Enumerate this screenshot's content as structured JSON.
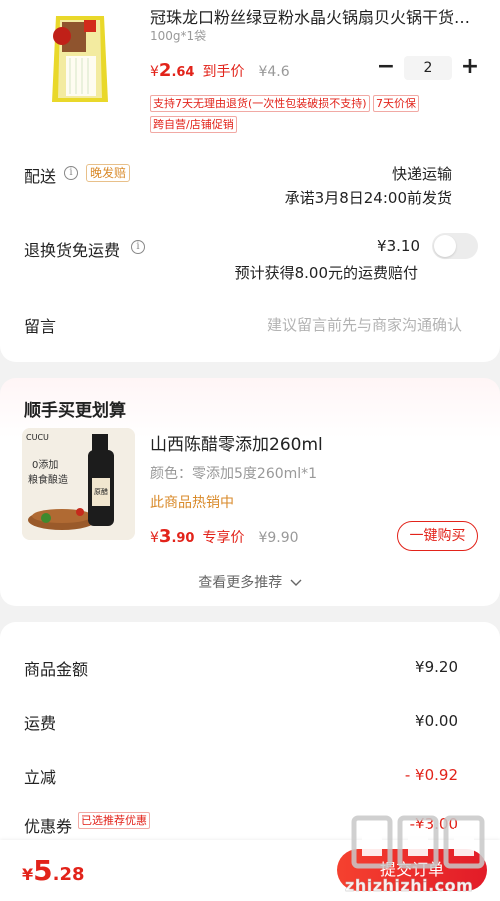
{
  "product": {
    "title": "冠珠龙口粉丝绿豆粉水晶火锅扇贝火锅干货粉丝",
    "spec": "100g*1袋",
    "currency": "¥",
    "price_int": "2",
    "price_dec": ".64",
    "price_tag": "到手价",
    "orig_price": "¥4.6",
    "quantity": "2",
    "minus": "−",
    "plus": "+",
    "tags": [
      "支持7天无理由退货(一次性包装破损不支持)",
      "7天价保",
      "跨自营/店铺促销"
    ]
  },
  "delivery": {
    "label": "配送",
    "info": "i",
    "late_badge": "晚发赔",
    "method": "快递运输",
    "promise": "承诺3月8日24:00前发货"
  },
  "return_shipping": {
    "label": "退换货免运费",
    "info": "i",
    "price": "¥3.10",
    "note": "预计获得8.00元的运费赔付"
  },
  "message": {
    "label": "留言",
    "placeholder": "建议留言前先与商家沟通确认"
  },
  "recommend": {
    "section_title": "顺手买更划算",
    "name": "山西陈醋零添加260ml",
    "spec": "颜色：零添加5度260ml*1",
    "hot": "此商品热销中",
    "currency": "¥",
    "price_int": "3",
    "price_dec": ".90",
    "price_tag": "专享价",
    "orig_price": "¥9.90",
    "buy_label": "一键购买",
    "more_label": "查看更多推荐",
    "image_text": {
      "brand": "CUCU",
      "line1": "0添加",
      "line2": "粮食酿造",
      "bottle_label": "原醋"
    }
  },
  "summary": {
    "goods_label": "商品金额",
    "goods_value": "¥9.20",
    "shipping_label": "运费",
    "shipping_value": "¥0.00",
    "discount_label": "立减",
    "discount_value": "- ¥0.92",
    "coupon_label": "优惠券",
    "coupon_badge": "已选推荐优惠",
    "coupon_value": "-¥3.00"
  },
  "bottom": {
    "currency": "¥",
    "total_int": "5",
    "total_dec": ".28",
    "submit_label": "提交订单"
  },
  "watermark": {
    "text": "zhizhizhi.com"
  },
  "colors": {
    "accent": "#e2231a",
    "warning": "#d98a2a",
    "muted": "#999999"
  }
}
